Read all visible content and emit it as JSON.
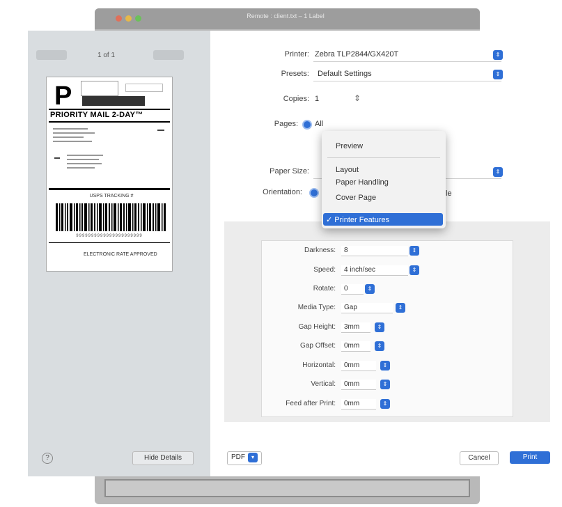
{
  "window": {
    "title": "Remote : client.txt – 1 Label"
  },
  "preview": {
    "page_indicator": "1 of 1"
  },
  "label": {
    "class_letter": "P",
    "service": "PRIORITY MAIL 2-DAY™",
    "tracking_title": "USPS TRACKING #",
    "tracking_number": "9999999999999999999999",
    "footer": "ELECTRONIC RATE APPROVED"
  },
  "form": {
    "printer_label": "Printer:",
    "printer_value": "Zebra TLP2844/GX420T",
    "presets_label": "Presets:",
    "presets_value": "Default Settings",
    "copies_label": "Copies:",
    "copies_value": "1",
    "pages_label": "Pages:",
    "pages_value": "All",
    "paper_size_label": "Paper Size:",
    "orientation_label": "Orientation:",
    "orientation_tail": "le"
  },
  "menu": {
    "items": [
      "Preview",
      "Layout",
      "Paper Handling",
      "Cover Page"
    ],
    "selected": "✓ Printer Features"
  },
  "features": {
    "rows": [
      {
        "label": "Darkness:",
        "value": "8"
      },
      {
        "label": "Speed:",
        "value": "4 inch/sec"
      },
      {
        "label": "Rotate:",
        "value": "0"
      },
      {
        "label": "Media Type:",
        "value": "Gap"
      },
      {
        "label": "Gap Height:",
        "value": "3mm"
      },
      {
        "label": "Gap Offset:",
        "value": "0mm"
      },
      {
        "label": "Horizontal:",
        "value": "0mm"
      },
      {
        "label": "Vertical:",
        "value": "0mm"
      },
      {
        "label": "Feed after Print:",
        "value": "0mm"
      }
    ]
  },
  "footer": {
    "help": "?",
    "hide_details": "Hide Details",
    "pdf": "PDF",
    "cancel": "Cancel",
    "print": "Print"
  },
  "colors": {
    "accent": "#2f6fd6",
    "sidebar": "#d9dde0",
    "panel": "#ececec"
  },
  "icons": [
    "help-icon",
    "stepper-icon",
    "popup-arrows-icon",
    "radio-icon",
    "checkmark-icon"
  ]
}
